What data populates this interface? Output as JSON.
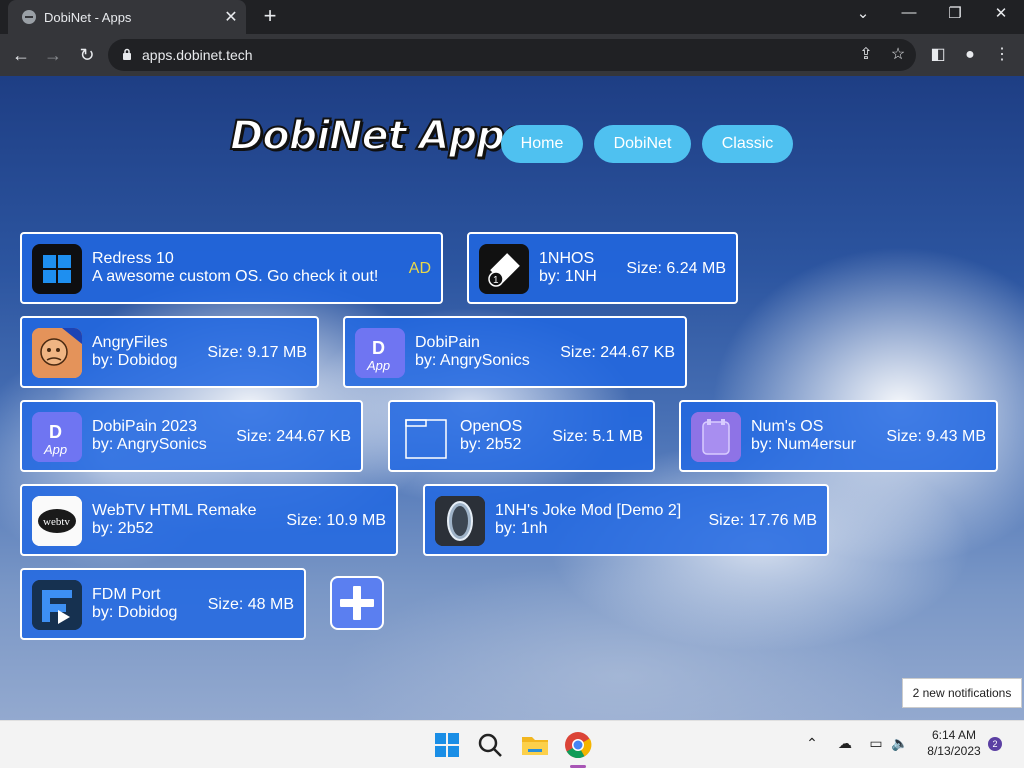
{
  "browser": {
    "tab_title": "DobiNet - Apps",
    "tab_close": "✕",
    "new_tab": "+",
    "url": "apps.dobinet.tech",
    "window_controls": {
      "dropdown": "⌄",
      "minimize": "—",
      "restore": "❐",
      "close": "✕"
    },
    "nav": {
      "back": "←",
      "forward": "→",
      "reload": "↻"
    },
    "toolbar_icons": [
      "share-icon",
      "star-icon",
      "side-panel-icon",
      "profile-icon",
      "menu-icon"
    ]
  },
  "header": {
    "logo": "DobiNet Apps",
    "nav": [
      {
        "label": "Home"
      },
      {
        "label": "DobiNet"
      },
      {
        "label": "Classic"
      }
    ]
  },
  "apps": [
    {
      "name": "Redress 10",
      "by": "A awesome custom OS. Go check it out!",
      "badge": "AD",
      "icon": "windows-icon"
    },
    {
      "name": "1NHOS",
      "by": "by: 1NH",
      "size": "Size: 6.24 MB",
      "icon": "1nhos-icon"
    },
    {
      "name": "AngryFiles",
      "by": "by: Dobidog",
      "size": "Size: 9.17 MB",
      "icon": "angryfiles-icon"
    },
    {
      "name": "DobiPain",
      "by": "by: AngrySonics",
      "size": "Size: 244.67 KB",
      "icon": "dobipain-icon"
    },
    {
      "name": "DobiPain 2023",
      "by": "by: AngrySonics",
      "size": "Size: 244.67 KB",
      "icon": "dobipain-icon"
    },
    {
      "name": "OpenOS",
      "by": "by: 2b52",
      "size": "Size: 5.1 MB",
      "icon": "folder-icon"
    },
    {
      "name": "Num's OS",
      "by": "by: Num4ersur",
      "size": "Size: 9.43 MB",
      "icon": "numsos-icon"
    },
    {
      "name": "WebTV HTML Remake",
      "by": "by: 2b52",
      "size": "Size: 10.9 MB",
      "icon": "webtv-icon"
    },
    {
      "name": "1NH's Joke Mod [Demo 2]",
      "by": "by: 1nh",
      "size": "Size: 17.76 MB",
      "icon": "portal-icon"
    },
    {
      "name": "FDM Port",
      "by": "by: Dobidog",
      "size": "Size: 48 MB",
      "icon": "fdm-icon"
    }
  ],
  "add_button_icon": "plus-icon",
  "toast": "2 new notifications",
  "taskbar": {
    "time": "6:14 AM",
    "date": "8/13/2023",
    "notification_count": "2"
  },
  "colors": {
    "card_bg": "#2167e2",
    "pill_bg": "#4fc1f0",
    "ad_text": "#e9d84a",
    "add_button": "#5b7ff0"
  }
}
